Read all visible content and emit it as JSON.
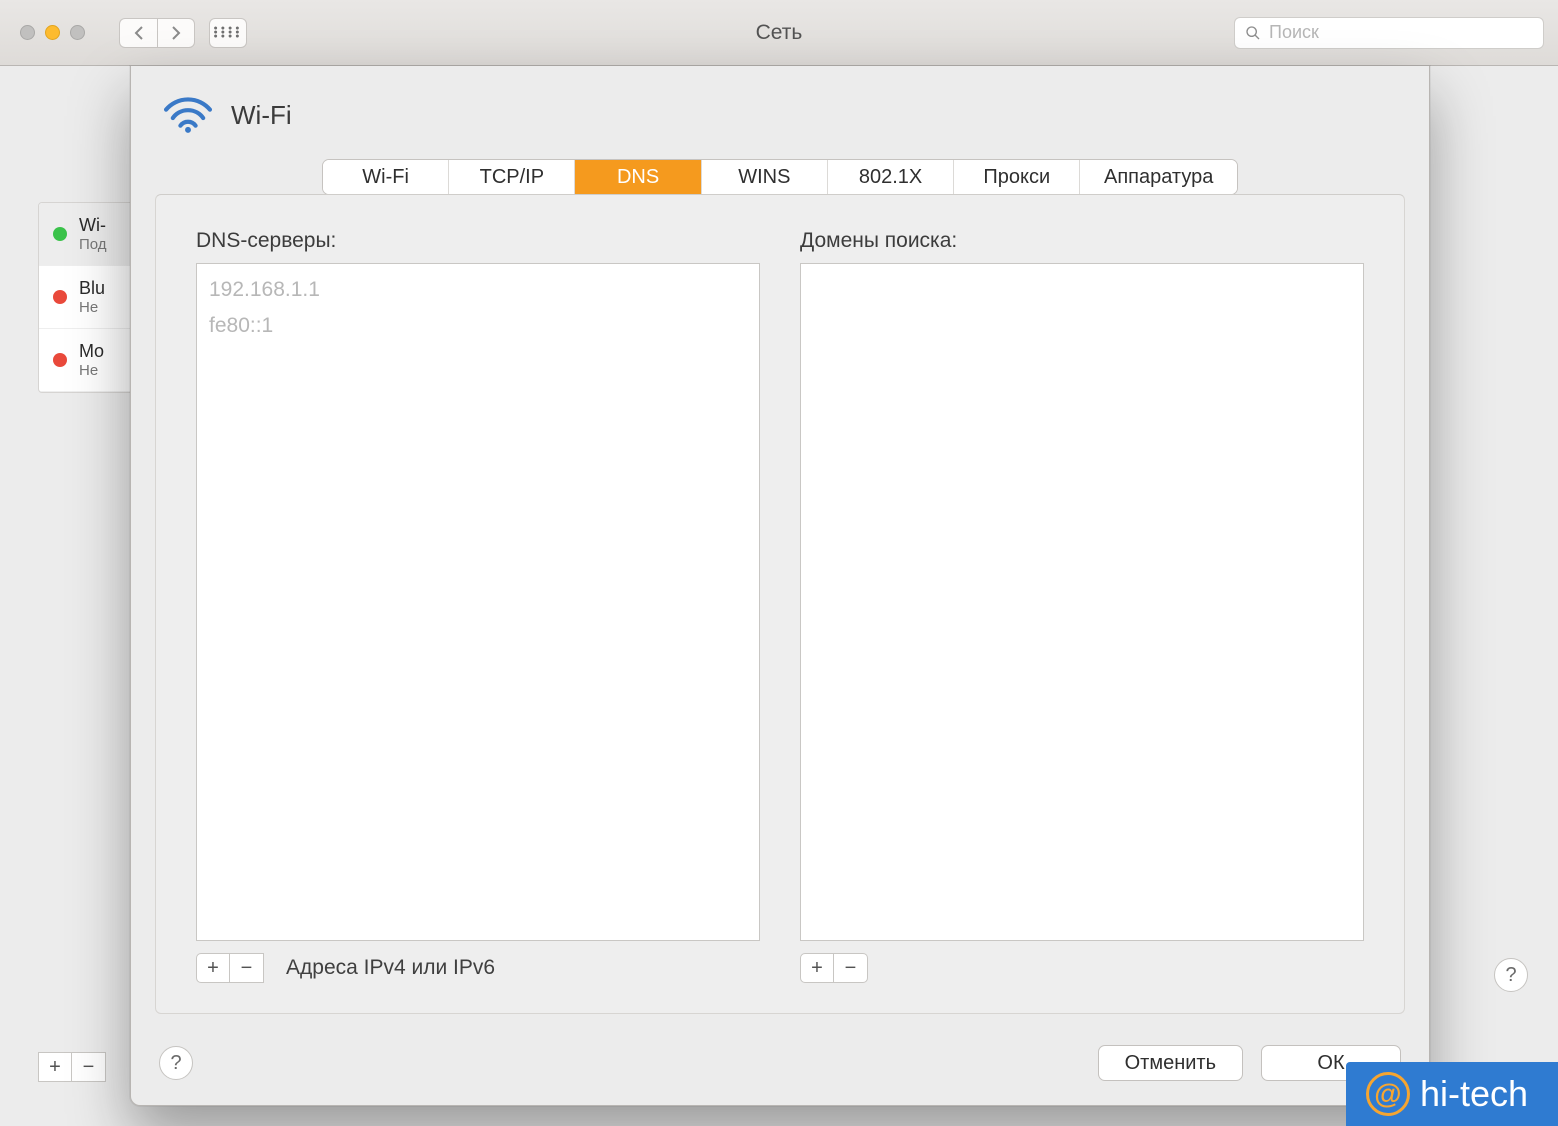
{
  "window": {
    "title": "Сеть",
    "search_placeholder": "Поиск"
  },
  "sidebar": {
    "items": [
      {
        "name": "Wi-",
        "sub": "Под",
        "status": "green",
        "selected": true
      },
      {
        "name": "Blu",
        "sub": "Не ",
        "status": "red",
        "selected": false
      },
      {
        "name": "Mo",
        "sub": "Не ",
        "status": "red",
        "selected": false
      }
    ]
  },
  "sheet": {
    "header_title": "Wi-Fi",
    "tabs": [
      "Wi-Fi",
      "TCP/IP",
      "DNS",
      "WINS",
      "802.1X",
      "Прокси",
      "Аппаратура"
    ],
    "active_tab": "DNS",
    "dns": {
      "servers_label": "DNS-серверы:",
      "servers": [
        "192.168.1.1",
        "fe80::1"
      ],
      "hint": "Адреса IPv4 или IPv6",
      "search_domains_label": "Домены поиска:",
      "search_domains": []
    },
    "buttons": {
      "help": "?",
      "cancel": "Отменить",
      "ok": "ОК",
      "add": "+",
      "remove": "−"
    }
  },
  "watermark": {
    "text": "hi-tech"
  }
}
